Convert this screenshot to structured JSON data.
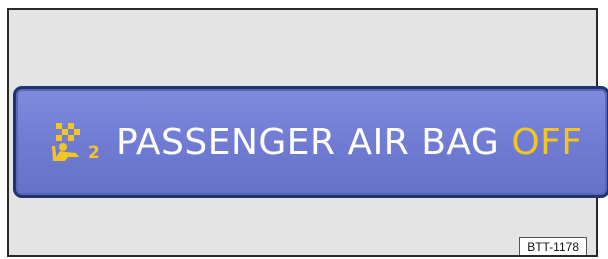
{
  "indicator": {
    "icon": "passenger-airbag-off-icon",
    "text": "PASSENGER AIR BAG",
    "state": "OFF",
    "colors": {
      "panel": "#6f7bd2",
      "panel_border": "#1e3370",
      "text": "#ffffff",
      "state": "#f4c51e",
      "background": "#e4e4e4"
    }
  },
  "figure_code": "BTT-1178"
}
